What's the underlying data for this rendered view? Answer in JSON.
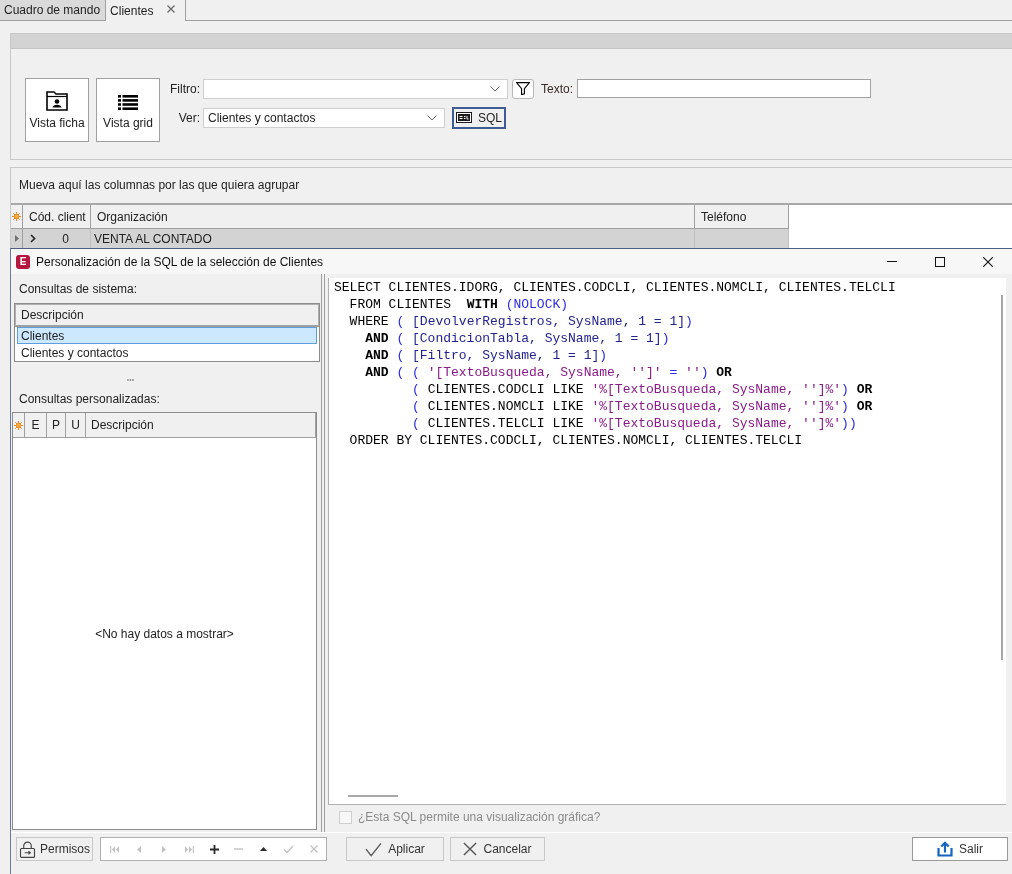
{
  "tabs": [
    {
      "label": "Cuadro de mando",
      "selected": false,
      "closable": false
    },
    {
      "label": "Clientes",
      "selected": true,
      "closable": true
    }
  ],
  "toolbar": {
    "view_buttons": [
      {
        "label": "Vista ficha",
        "kind": "card"
      },
      {
        "label": "Vista grid",
        "kind": "grid"
      }
    ],
    "filter": {
      "label": "Filtro:"
    },
    "text_search": {
      "label": "Texto:"
    },
    "view": {
      "label": "Ver:",
      "value": "Clientes y contactos"
    },
    "sql_button": {
      "label": "SQL",
      "pressed": true
    }
  },
  "grid": {
    "group_hint": "Mueva aquí las columnas por las que quiera agrupar",
    "columns": [
      {
        "label": "Cód. client"
      },
      {
        "label": "Organización"
      },
      {
        "label": "Teléfono"
      }
    ],
    "rows": [
      {
        "code": "0",
        "organization": "VENTA AL CONTADO",
        "expanded": false,
        "selected": true
      }
    ]
  },
  "dialog": {
    "logo": "E",
    "title": "Personalización de la SQL de la selección de Clientes",
    "system_queries": {
      "label": "Consultas de sistema:",
      "column": "Descripción",
      "rows": [
        {
          "label": "Clientes",
          "selected": true
        },
        {
          "label": "Clientes y contactos",
          "selected": false
        }
      ]
    },
    "custom_queries": {
      "label": "Consultas personalizadas:",
      "columns": [
        {
          "label": "E"
        },
        {
          "label": "P"
        },
        {
          "label": "U"
        },
        {
          "label": "Descripción"
        }
      ],
      "empty_text": "<No hay datos a mostrar>"
    },
    "sql_lines": [
      [
        {
          "kind": "plain",
          "text": "SELECT CLIENTES.IDORG, CLIENTES.CODCLI, CLIENTES.NOMCLI, CLIENTES.TELCLI"
        }
      ],
      [
        {
          "kind": "plain",
          "text": "  FROM CLIENTES  "
        },
        {
          "kind": "keyword",
          "text": "WITH"
        },
        {
          "kind": "op",
          "text": " (NOLOCK)"
        }
      ],
      [
        {
          "kind": "plain",
          "text": "  WHERE "
        },
        {
          "kind": "op",
          "text": "( "
        },
        {
          "kind": "param",
          "text": "[DevolverRegistros, SysName, 1 = 1]"
        },
        {
          "kind": "op",
          "text": ")"
        }
      ],
      [
        {
          "kind": "keyword",
          "text": "    AND"
        },
        {
          "kind": "op",
          "text": " ( "
        },
        {
          "kind": "param",
          "text": "[CondicionTabla, SysName, 1 = 1]"
        },
        {
          "kind": "op",
          "text": ")"
        }
      ],
      [
        {
          "kind": "keyword",
          "text": "    AND"
        },
        {
          "kind": "op",
          "text": " ( "
        },
        {
          "kind": "param",
          "text": "[Filtro, SysName, 1 = 1]"
        },
        {
          "kind": "op",
          "text": ")"
        }
      ],
      [
        {
          "kind": "keyword",
          "text": "    AND"
        },
        {
          "kind": "op",
          "text": " ( ( "
        },
        {
          "kind": "string",
          "text": "'[TextoBusqueda, SysName, '']'"
        },
        {
          "kind": "op",
          "text": " = "
        },
        {
          "kind": "string",
          "text": "''"
        },
        {
          "kind": "op",
          "text": ") "
        },
        {
          "kind": "keyword",
          "text": "OR"
        }
      ],
      [
        {
          "kind": "op",
          "text": "          ( "
        },
        {
          "kind": "plain",
          "text": "CLIENTES.CODCLI LIKE "
        },
        {
          "kind": "string",
          "text": "'%[TextoBusqueda, SysName, '']%'"
        },
        {
          "kind": "op",
          "text": ") "
        },
        {
          "kind": "keyword",
          "text": "OR"
        }
      ],
      [
        {
          "kind": "op",
          "text": "          ( "
        },
        {
          "kind": "plain",
          "text": "CLIENTES.NOMCLI LIKE "
        },
        {
          "kind": "string",
          "text": "'%[TextoBusqueda, SysName, '']%'"
        },
        {
          "kind": "op",
          "text": ") "
        },
        {
          "kind": "keyword",
          "text": "OR"
        }
      ],
      [
        {
          "kind": "op",
          "text": "          ( "
        },
        {
          "kind": "plain",
          "text": "CLIENTES.TELCLI LIKE "
        },
        {
          "kind": "string",
          "text": "'%[TextoBusqueda, SysName, '']%'"
        },
        {
          "kind": "op",
          "text": "))"
        }
      ],
      [
        {
          "kind": "plain",
          "text": "  ORDER BY CLIENTES.CODCLI, CLIENTES.NOMCLI, CLIENTES.TELCLI"
        }
      ]
    ],
    "graph_option": {
      "label": "¿Esta SQL permite una visualización gráfica?",
      "checked": false,
      "disabled": true
    },
    "permissions_button": {
      "label": "Permisos"
    },
    "navigator": [
      {
        "kind": "first",
        "disabled": true
      },
      {
        "kind": "prev",
        "disabled": true
      },
      {
        "kind": "next",
        "disabled": true
      },
      {
        "kind": "last",
        "disabled": true
      },
      {
        "kind": "add",
        "disabled": false
      },
      {
        "kind": "delete",
        "disabled": true
      },
      {
        "kind": "edit",
        "disabled": false
      },
      {
        "kind": "post",
        "disabled": true
      },
      {
        "kind": "cancel",
        "disabled": true
      }
    ],
    "action_buttons": [
      {
        "kind": "apply",
        "label": "Aplicar"
      },
      {
        "kind": "cancel",
        "label": "Cancelar"
      }
    ],
    "exit_button": {
      "label": "Salir",
      "focused": true
    }
  }
}
